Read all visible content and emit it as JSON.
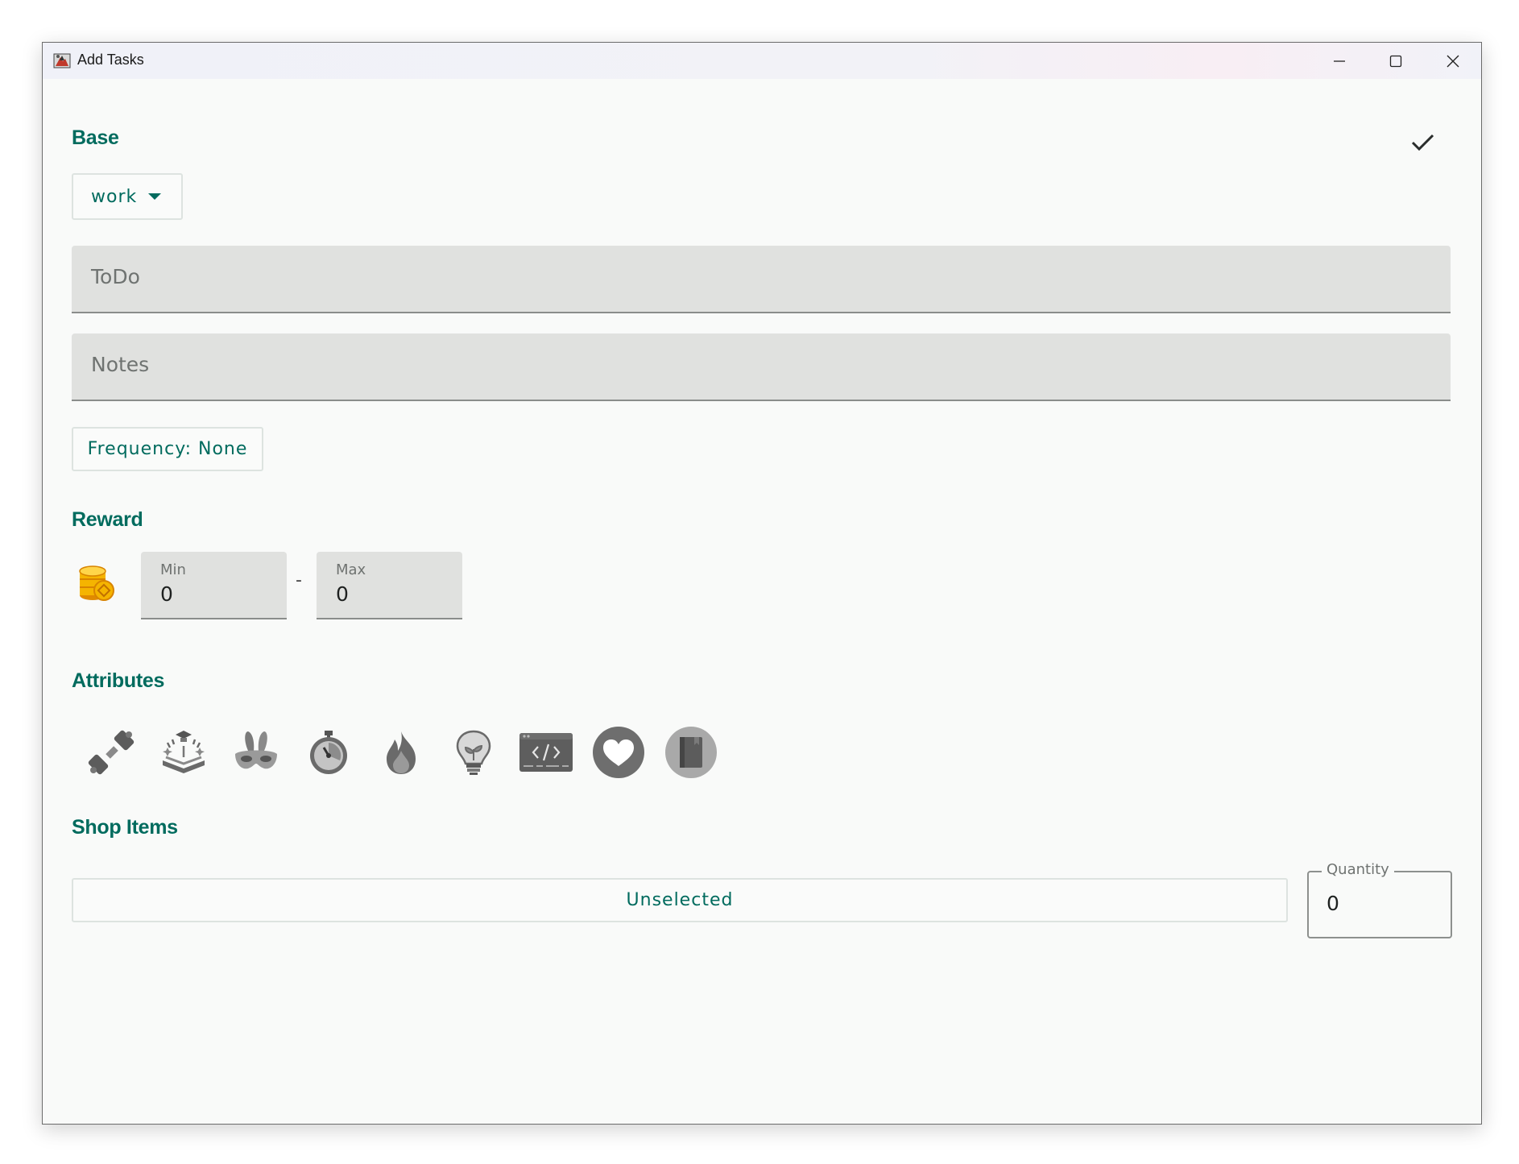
{
  "window": {
    "title": "Add Tasks",
    "controls": [
      "minimize-icon",
      "maximize-icon",
      "close-icon"
    ]
  },
  "base": {
    "title": "Base",
    "category": "work",
    "todo_placeholder": "ToDo",
    "notes_placeholder": "Notes",
    "frequency": "Frequency: None"
  },
  "reward": {
    "title": "Reward",
    "icon": "coins-icon",
    "min_label": "Min",
    "min_value": "0",
    "separator": "-",
    "max_label": "Max",
    "max_value": "0"
  },
  "attributes": {
    "title": "Attributes",
    "icons": [
      "dumbbell-icon",
      "graduation-book-icon",
      "bunny-mask-icon",
      "stopwatch-icon",
      "flame-icon",
      "lightbulb-icon",
      "code-window-icon",
      "heart-icon",
      "book-icon"
    ]
  },
  "shop": {
    "title": "Shop Items",
    "item": "Unselected",
    "quantity_label": "Quantity",
    "quantity_value": "0"
  },
  "colors": {
    "accent": "#006b5e",
    "field_bg": "#e0e1df",
    "window_bg": "#f9faf9",
    "icon_gray": "#6e6e6e"
  }
}
